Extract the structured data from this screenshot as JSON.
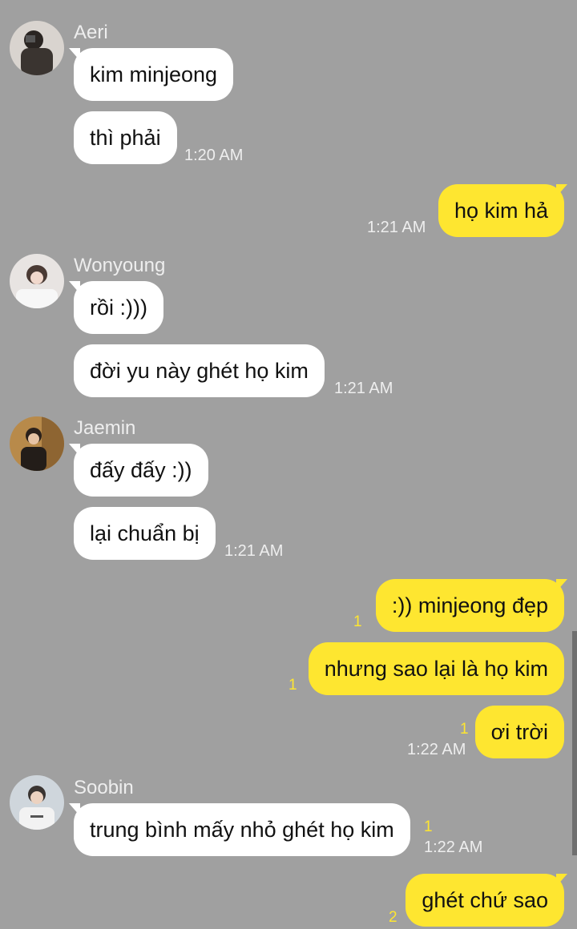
{
  "colors": {
    "background": "#a0a0a0",
    "incoming_bubble": "#ffffff",
    "outgoing_bubble": "#fee630",
    "unread_count": "#fee630",
    "meta_text": "#eeeeee"
  },
  "groups": [
    {
      "sender": "Aeri",
      "avatar": "avatar-aeri",
      "messages": [
        "kim minjeong",
        "thì phải"
      ],
      "time": "1:20 AM"
    },
    {
      "sender": "me",
      "messages": [
        "họ kim hả"
      ],
      "time": "1:21 AM"
    },
    {
      "sender": "Wonyoung",
      "avatar": "avatar-wonyoung",
      "messages": [
        "rồi :)))",
        "đời yu này ghét họ kim"
      ],
      "time": "1:21 AM"
    },
    {
      "sender": "Jaemin",
      "avatar": "avatar-jaemin",
      "messages": [
        "đấy đấy :))",
        "lại chuẩn bị"
      ],
      "time": "1:21 AM"
    },
    {
      "sender": "me",
      "messages": [
        ":)) minjeong đẹp",
        "nhưng sao lại là họ kim",
        "ơi trời"
      ],
      "unread": [
        "1",
        "1",
        "1"
      ],
      "time": "1:22 AM"
    },
    {
      "sender": "Soobin",
      "avatar": "avatar-soobin",
      "messages": [
        "trung bình mấy nhỏ ghét họ kim"
      ],
      "unread": [
        "1"
      ],
      "time": "1:22 AM"
    },
    {
      "sender": "me",
      "messages": [
        "ghét chứ sao"
      ],
      "unread": [
        "2"
      ]
    }
  ]
}
